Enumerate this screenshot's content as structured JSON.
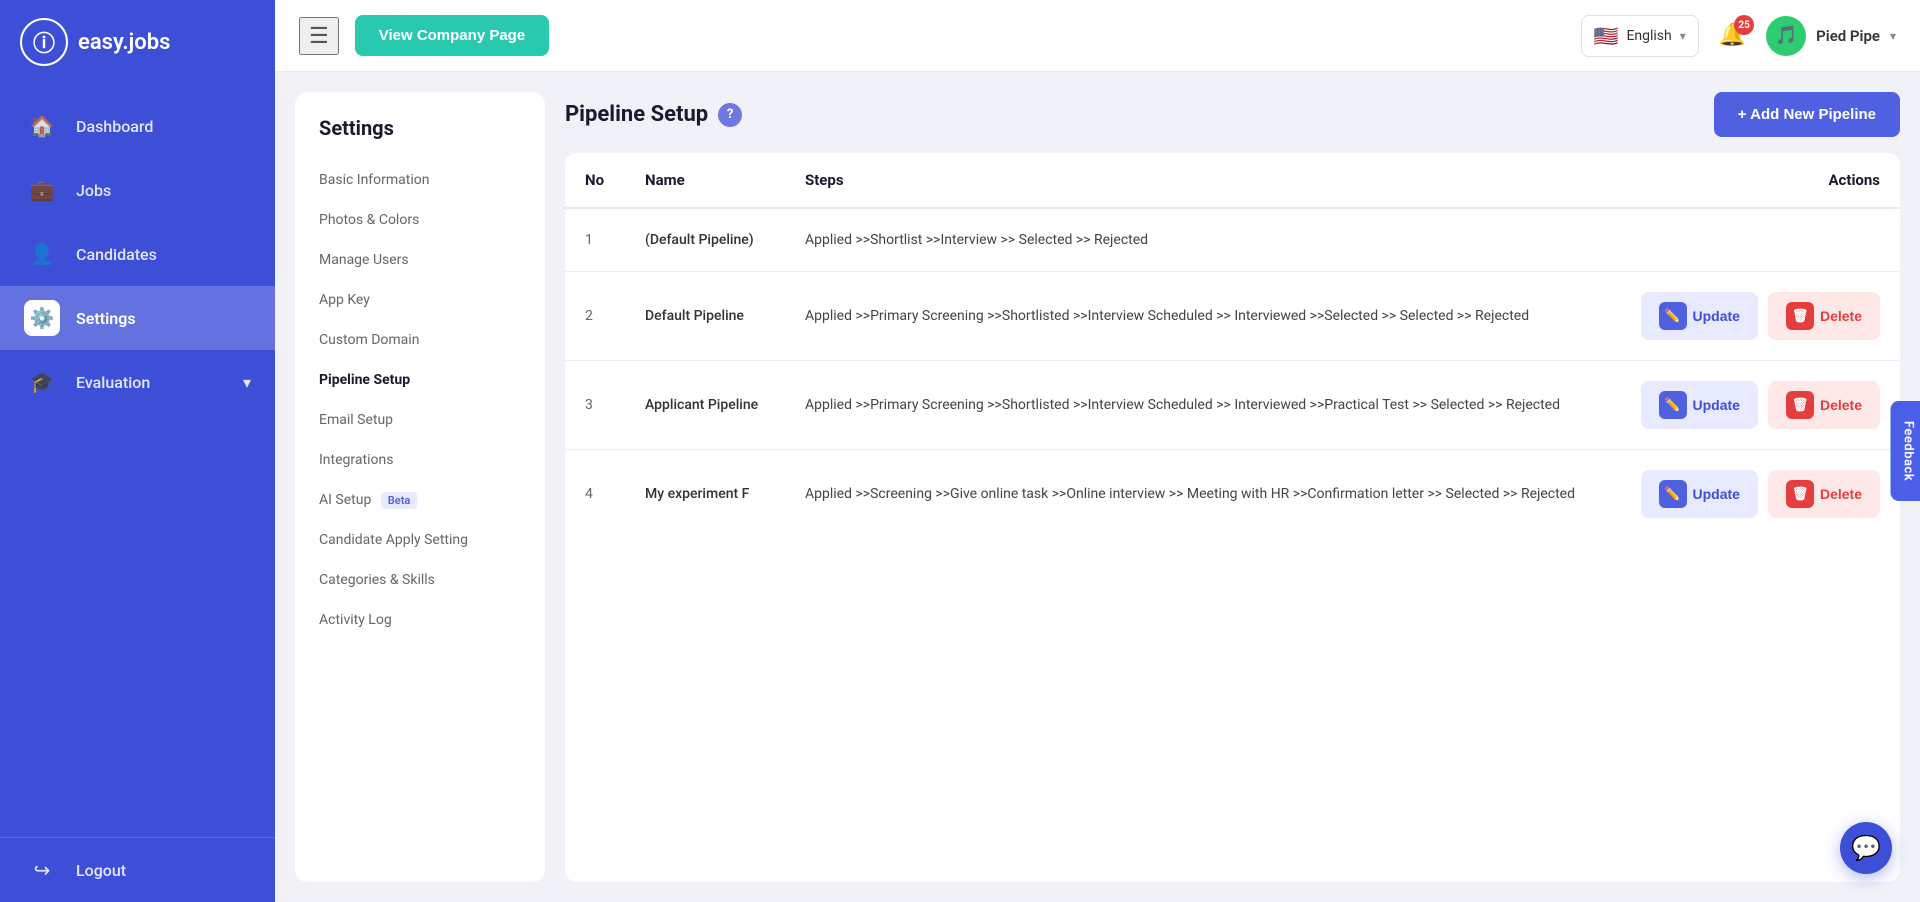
{
  "app": {
    "name": "easy.jobs",
    "logo_char": "ⓘ"
  },
  "sidebar": {
    "items": [
      {
        "id": "dashboard",
        "label": "Dashboard",
        "icon": "🏠",
        "active": false
      },
      {
        "id": "jobs",
        "label": "Jobs",
        "icon": "💼",
        "active": false
      },
      {
        "id": "candidates",
        "label": "Candidates",
        "icon": "👤",
        "active": false
      },
      {
        "id": "settings",
        "label": "Settings",
        "icon": "⚙️",
        "active": true
      },
      {
        "id": "evaluation",
        "label": "Evaluation",
        "icon": "🎓",
        "active": false
      }
    ],
    "logout_label": "Logout"
  },
  "topbar": {
    "view_company_btn": "View Company Page",
    "lang": "English",
    "notif_count": "25",
    "user_name": "Pied Pipe"
  },
  "settings_menu": {
    "title": "Settings",
    "items": [
      {
        "label": "Basic Information",
        "active": false
      },
      {
        "label": "Photos & Colors",
        "active": false
      },
      {
        "label": "Manage Users",
        "active": false
      },
      {
        "label": "App Key",
        "active": false
      },
      {
        "label": "Custom Domain",
        "active": false
      },
      {
        "label": "Pipeline Setup",
        "active": true
      },
      {
        "label": "Email Setup",
        "active": false
      },
      {
        "label": "Integrations",
        "active": false
      },
      {
        "label": "AI Setup",
        "active": false,
        "badge": "Beta"
      },
      {
        "label": "Candidate Apply Setting",
        "active": false
      },
      {
        "label": "Categories & Skills",
        "active": false
      },
      {
        "label": "Activity Log",
        "active": false
      }
    ]
  },
  "pipeline": {
    "title": "Pipeline Setup",
    "add_btn": "+ Add New Pipeline",
    "table": {
      "headers": [
        "No",
        "Name",
        "Steps",
        "Actions"
      ],
      "rows": [
        {
          "no": "1",
          "name": "(Default Pipeline)",
          "steps": "Applied >>Shortlist >>Interview >> Selected >> Rejected",
          "has_actions": false
        },
        {
          "no": "2",
          "name": "Default Pipeline",
          "steps": "Applied >>Primary Screening >>Shortlisted >>Interview Scheduled >> Interviewed >>Selected >> Selected >> Rejected",
          "has_actions": true
        },
        {
          "no": "3",
          "name": "Applicant Pipeline",
          "steps": "Applied >>Primary Screening >>Shortlisted >>Interview Scheduled >> Interviewed >>Practical Test >> Selected >> Rejected",
          "has_actions": true
        },
        {
          "no": "4",
          "name": "My experiment F",
          "steps": "Applied >>Screening >>Give online task >>Online interview >> Meeting with HR >>Confirmation letter >> Selected >> Rejected",
          "has_actions": true
        }
      ],
      "update_label": "Update",
      "delete_label": "Delete"
    }
  },
  "feedback": "Feedback",
  "chat_icon": "💬"
}
